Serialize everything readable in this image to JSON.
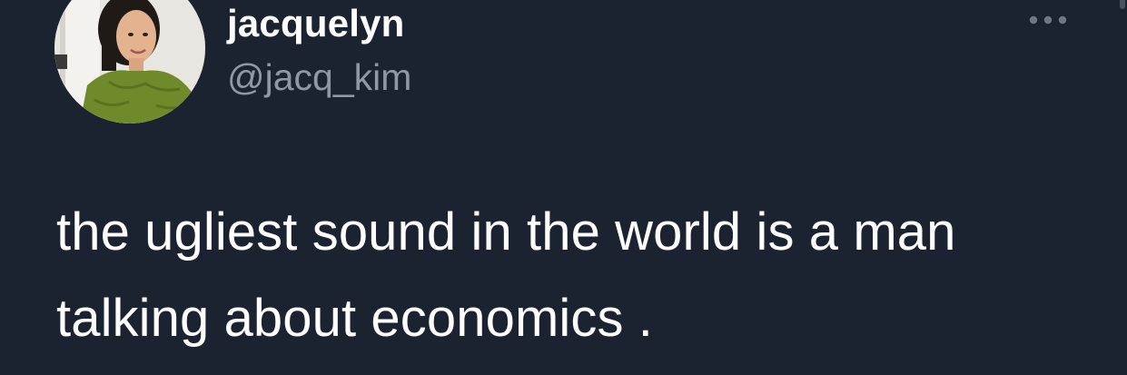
{
  "author": {
    "display_name": "jacquelyn",
    "handle": "@jacq_kim",
    "avatar_icon": "profile-photo"
  },
  "menu": {
    "icon": "more-horizontal-icon"
  },
  "tweet": {
    "lines": [
      "the ugliest sound in the world is a man",
      "talking about economics ."
    ]
  },
  "colors": {
    "background": "#1b2230",
    "text_primary": "#ffffff",
    "text_secondary": "#8f99a6"
  }
}
